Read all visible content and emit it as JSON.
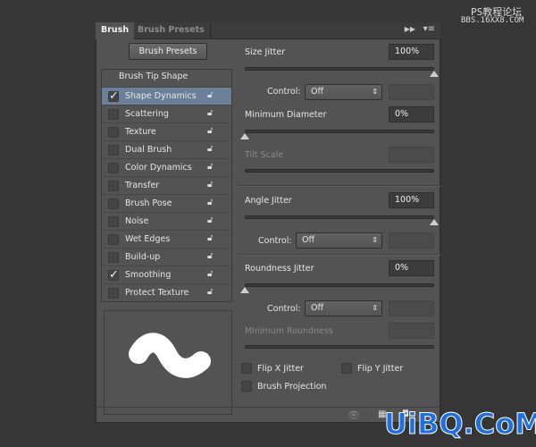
{
  "tabs": [
    {
      "label": "Brush",
      "active": true
    },
    {
      "label": "Brush Presets",
      "active": false
    }
  ],
  "panel_icons": {
    "collapse": "double-arrow-right-icon",
    "menu": "panel-menu-icon"
  },
  "presets_button": "Brush Presets",
  "brush_tip_shape": "Brush Tip Shape",
  "options": [
    {
      "label": "Shape Dynamics",
      "checked": true,
      "selected": true
    },
    {
      "label": "Scattering",
      "checked": false
    },
    {
      "label": "Texture",
      "checked": false
    },
    {
      "label": "Dual Brush",
      "checked": false
    },
    {
      "label": "Color Dynamics",
      "checked": false
    },
    {
      "label": "Transfer",
      "checked": false
    },
    {
      "label": "Brush Pose",
      "checked": false
    },
    {
      "label": "Noise",
      "checked": false
    },
    {
      "label": "Wet Edges",
      "checked": false
    },
    {
      "label": "Build-up",
      "checked": false
    },
    {
      "label": "Smoothing",
      "checked": true
    },
    {
      "label": "Protect Texture",
      "checked": false
    }
  ],
  "settings": {
    "size_jitter": {
      "label": "Size Jitter",
      "value": "100%",
      "slider": 100
    },
    "control1": {
      "label": "Control:",
      "value": "Off"
    },
    "min_diameter": {
      "label": "Minimum Diameter",
      "value": "0%",
      "slider": 0
    },
    "tilt_scale": {
      "label": "Tilt Scale",
      "disabled": true
    },
    "angle_jitter": {
      "label": "Angle Jitter",
      "value": "100%",
      "slider": 100
    },
    "control2": {
      "label": "Control:",
      "value": "Off"
    },
    "roundness_jitter": {
      "label": "Roundness Jitter",
      "value": "0%",
      "slider": 0
    },
    "control3": {
      "label": "Control:",
      "value": "Off"
    },
    "min_roundness": {
      "label": "Minimum Roundness",
      "disabled": true
    },
    "flip_x": {
      "label": "Flip X Jitter",
      "checked": false
    },
    "flip_y": {
      "label": "Flip Y Jitter",
      "checked": false
    },
    "brush_projection": {
      "label": "Brush Projection",
      "checked": false
    }
  },
  "watermarks": {
    "top_line1": "PS教程论坛",
    "top_line2": "BBS.16XX8.COM",
    "bottom": "UiBQ.CoM"
  }
}
